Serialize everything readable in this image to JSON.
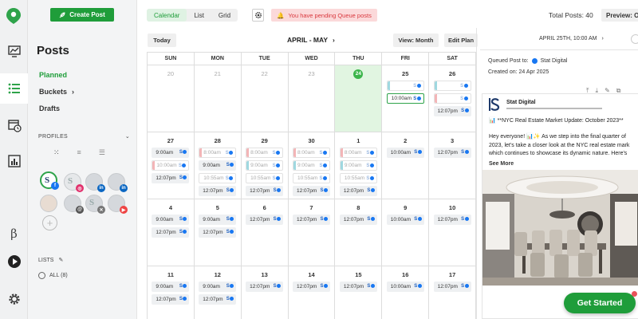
{
  "sidebar": {
    "create_label": "Create Post",
    "title": "Posts",
    "nav": [
      {
        "label": "Planned",
        "active": true
      },
      {
        "label": "Buckets"
      },
      {
        "label": "Drafts"
      }
    ],
    "profiles_label": "PROFILES",
    "lists_label": "LISTS",
    "all_label": "ALL (8)"
  },
  "toolbar": {
    "tabs": [
      "Calendar",
      "List",
      "Grid"
    ],
    "pending": "You have pending Queue posts",
    "total_posts": "Total Posts: 40",
    "preview": "Preview: On"
  },
  "calendar": {
    "today_btn": "Today",
    "range": "APRIL - MAY",
    "view_btn": "View: Month",
    "edit_btn": "Edit Plan",
    "weekdays": [
      "SUN",
      "MON",
      "TUE",
      "WED",
      "THU",
      "FRI",
      "SAT"
    ],
    "weeks": [
      [
        {
          "n": "20",
          "past": true,
          "slots": []
        },
        {
          "n": "21",
          "past": true,
          "slots": []
        },
        {
          "n": "22",
          "past": true,
          "slots": []
        },
        {
          "n": "23",
          "past": true,
          "slots": []
        },
        {
          "n": "24",
          "today": true,
          "slots": []
        },
        {
          "n": "25",
          "slots": [
            {
              "t": "",
              "faded": true,
              "c": "#9fd8e0"
            },
            {
              "t": "10:00am",
              "outlined": true
            }
          ]
        },
        {
          "n": "26",
          "slots": [
            {
              "t": "",
              "faded": true,
              "c": "#9fd8e0"
            },
            {
              "t": "",
              "faded": true,
              "c": "#f3b5b7"
            },
            {
              "t": "12:07pm"
            }
          ]
        }
      ],
      [
        {
          "n": "27",
          "slots": [
            {
              "t": "9:00am"
            },
            {
              "t": "10:00am",
              "faded": true,
              "c": "#f3b5b7"
            },
            {
              "t": "12:07pm"
            }
          ]
        },
        {
          "n": "28",
          "slots": [
            {
              "t": "8:00am",
              "faded": true,
              "c": "#f3b5b7"
            },
            {
              "t": "9:00am"
            },
            {
              "t": "10:55am",
              "faded": true
            },
            {
              "t": "12:07pm"
            }
          ]
        },
        {
          "n": "29",
          "slots": [
            {
              "t": "8:00am",
              "faded": true,
              "c": "#f3b5b7"
            },
            {
              "t": "9:00am",
              "faded": true,
              "c": "#9fd8e0"
            },
            {
              "t": "10:55am",
              "faded": true
            },
            {
              "t": "12:07pm"
            }
          ]
        },
        {
          "n": "30",
          "slots": [
            {
              "t": "8:00am",
              "faded": true,
              "c": "#f3b5b7"
            },
            {
              "t": "9:00am",
              "faded": true,
              "c": "#9fd8e0"
            },
            {
              "t": "10:55am",
              "faded": true
            },
            {
              "t": "12:07pm"
            }
          ]
        },
        {
          "n": "1",
          "slots": [
            {
              "t": "8:00am",
              "faded": true,
              "c": "#f3b5b7"
            },
            {
              "t": "9:00am",
              "faded": true,
              "c": "#9fd8e0"
            },
            {
              "t": "10:55am",
              "faded": true
            },
            {
              "t": "12:07pm"
            }
          ]
        },
        {
          "n": "2",
          "slots": [
            {
              "t": "10:00am"
            }
          ]
        },
        {
          "n": "3",
          "slots": [
            {
              "t": "12:07pm"
            }
          ]
        }
      ],
      [
        {
          "n": "4",
          "slots": [
            {
              "t": "9:00am"
            },
            {
              "t": "12:07pm"
            }
          ]
        },
        {
          "n": "5",
          "slots": [
            {
              "t": "9:00am"
            },
            {
              "t": "12:07pm"
            }
          ]
        },
        {
          "n": "6",
          "slots": [
            {
              "t": "12:07pm"
            }
          ]
        },
        {
          "n": "7",
          "slots": [
            {
              "t": "12:07pm"
            }
          ]
        },
        {
          "n": "8",
          "slots": [
            {
              "t": "12:07pm"
            }
          ]
        },
        {
          "n": "9",
          "slots": [
            {
              "t": "10:00am"
            }
          ]
        },
        {
          "n": "10",
          "slots": [
            {
              "t": "12:07pm"
            }
          ]
        }
      ],
      [
        {
          "n": "11",
          "slots": [
            {
              "t": "9:00am"
            },
            {
              "t": "12:07pm"
            }
          ]
        },
        {
          "n": "12",
          "slots": [
            {
              "t": "9:00am"
            },
            {
              "t": "12:07pm"
            }
          ]
        },
        {
          "n": "13",
          "slots": [
            {
              "t": "12:07pm"
            }
          ]
        },
        {
          "n": "14",
          "slots": [
            {
              "t": "12:07pm"
            }
          ]
        },
        {
          "n": "15",
          "slots": [
            {
              "t": "12:07pm"
            }
          ]
        },
        {
          "n": "16",
          "slots": [
            {
              "t": "10:00am"
            }
          ]
        },
        {
          "n": "17",
          "slots": [
            {
              "t": "12:07pm"
            }
          ]
        }
      ]
    ]
  },
  "preview": {
    "date": "APRIL 25TH, 10:00 AM",
    "queued_prefix": "Queued Post to:",
    "queued_profile": "Stat Digital",
    "created": "Created on: 24 Apr 2025",
    "post_name": "Stat Digital",
    "post_title": "📊 **NYC Real Estate Market Update: October 2023**",
    "post_body": [
      "Hey everyone! 📊✨ As we step into the final quarter of",
      "2023, let's take a closer look at the NYC real estate mark",
      "which continues to showcase its dynamic nature. Here's"
    ],
    "see_more": "See More"
  },
  "cta": "Get Started",
  "colors": {
    "brand": "#1f9d3a",
    "today_bg": "#e1f5e1",
    "pending_bg": "#fbd9da",
    "pending_text": "#d9383e"
  }
}
